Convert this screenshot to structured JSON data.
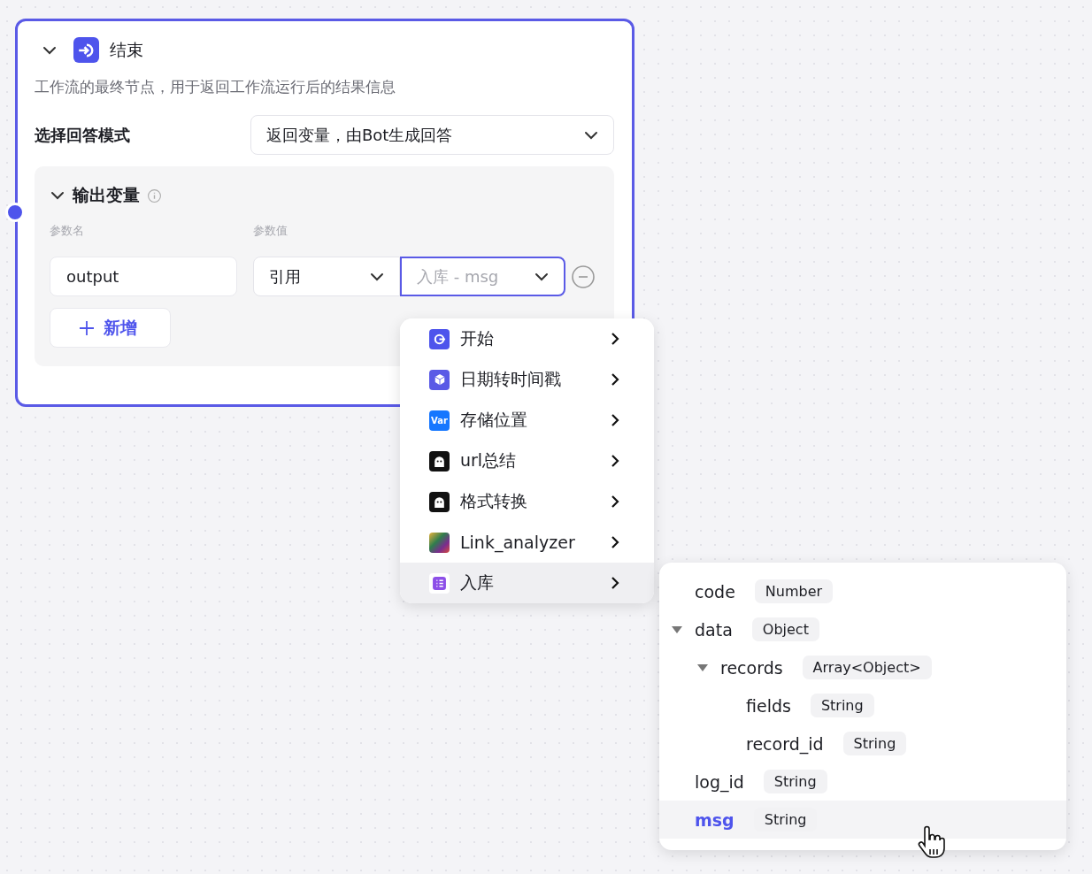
{
  "node": {
    "title": "结束",
    "expanded": true,
    "description": "工作流的最终节点，用于返回工作流运行后的结果信息",
    "selected": true
  },
  "answer_mode": {
    "label": "选择回答模式",
    "value": "返回变量，由Bot生成回答"
  },
  "output_section": {
    "title": "输出变量",
    "expanded": true,
    "columns": [
      "参数名",
      "参数值"
    ],
    "rows": [
      {
        "name": "output",
        "source": "引用",
        "value_placeholder": "入库 - msg",
        "focused": true
      }
    ],
    "add_button": "新增"
  },
  "node_menu": {
    "items": [
      {
        "label": "开始",
        "kind": "start",
        "selected": false
      },
      {
        "label": "日期转时间戳",
        "kind": "plugin",
        "selected": false
      },
      {
        "label": "存储位置",
        "kind": "variable",
        "icon_text": "Var",
        "selected": false
      },
      {
        "label": "url总结",
        "kind": "bot",
        "selected": false
      },
      {
        "label": "格式转换",
        "kind": "bot",
        "selected": false
      },
      {
        "label": "Link_analyzer",
        "kind": "image",
        "selected": false
      },
      {
        "label": "入库",
        "kind": "database",
        "selected": true
      }
    ]
  },
  "field_menu": {
    "items": [
      {
        "name": "code",
        "type": "Number",
        "selected": false
      },
      {
        "name": "data",
        "type": "Object",
        "selected": false,
        "expanded": true,
        "children": [
          {
            "name": "records",
            "type": "Array<Object>",
            "selected": false,
            "expanded": true,
            "children": [
              {
                "name": "fields",
                "type": "String",
                "selected": false
              },
              {
                "name": "record_id",
                "type": "String",
                "selected": false
              }
            ]
          }
        ]
      },
      {
        "name": "log_id",
        "type": "String",
        "selected": false
      },
      {
        "name": "msg",
        "type": "String",
        "selected": true
      }
    ]
  }
}
